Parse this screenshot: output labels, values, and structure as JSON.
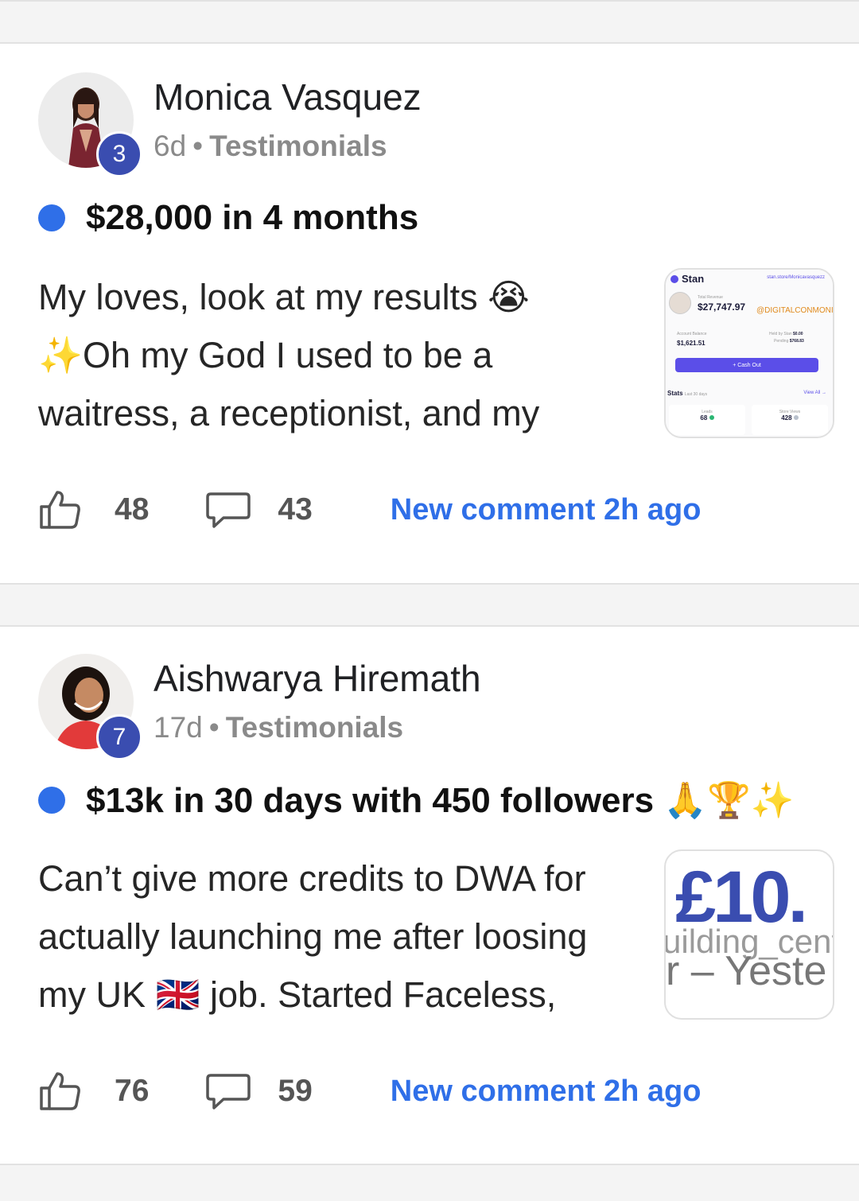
{
  "posts": [
    {
      "author": "Monica Vasquez",
      "level": "3",
      "age": "6d",
      "separator": "•",
      "category": "Testimonials",
      "title": "$28,000 in 4 months",
      "body": [
        "My loves, look at my results 😭",
        "✨Oh my God I used to be a",
        "waitress, a receptionist, and my"
      ],
      "likes": "48",
      "comments": "43",
      "new_comment": "New comment 2h ago",
      "thumbnail": {
        "brand": "Stan",
        "url": "stan.store/Monicavasquezz",
        "total_revenue_label": "Total Revenue",
        "total_revenue": "$27,747.97",
        "handle": "@DIGITALCONMONI",
        "account_balance_label": "Account Balance",
        "account_balance": "$1,621.51",
        "held_label": "Held by Stan",
        "held": "$0.00",
        "pending_label": "Pending",
        "pending": "$768.83",
        "cash_out": "+ Cash Out",
        "stats": "Stats",
        "stats_range": "Last 30 days",
        "view_all": "View All →",
        "leads_label": "Leads",
        "leads": "68",
        "views_label": "Store Views",
        "views": "428"
      }
    },
    {
      "author": "Aishwarya Hiremath",
      "level": "7",
      "age": "17d",
      "separator": "•",
      "category": "Testimonials",
      "title": "$13k in 30 days with 450 followers 🙏🏆✨",
      "body": [
        "Can’t give more credits to DWA for",
        "actually launching me after loosing",
        "my UK 🇬🇧 job. Started Faceless,"
      ],
      "likes": "76",
      "comments": "59",
      "new_comment": "New comment 2h ago",
      "thumbnail": {
        "big": "£10.",
        "mid": "uilding_cent",
        "low": "r – Yeste"
      }
    }
  ],
  "colors": {
    "accent": "#2f6fe8",
    "level_badge": "#3a4db0",
    "stan_button": "#5b4ee8"
  },
  "icons": {
    "like": "thumbs-up-icon",
    "comment": "comment-bubble-icon"
  }
}
